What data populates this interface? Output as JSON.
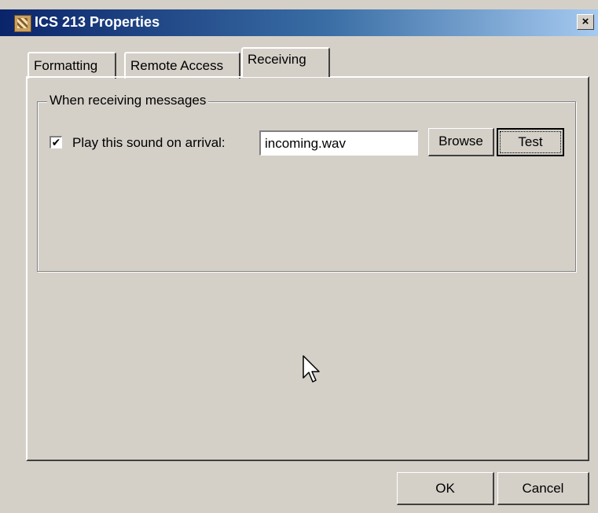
{
  "window": {
    "title": "ICS 213 Properties",
    "close_glyph": "×",
    "icon": "app-icon"
  },
  "tabs": [
    {
      "label": "Formatting",
      "active": false
    },
    {
      "label": "Remote Access",
      "active": false
    },
    {
      "label": "Receiving",
      "active": true
    }
  ],
  "receiving": {
    "group_label": "When receiving messages",
    "play_sound_checked": true,
    "check_glyph": "✔",
    "play_sound_label": "Play this sound on arrival:",
    "sound_file": "incoming.wav",
    "browse_label": "Browse",
    "test_label": "Test"
  },
  "footer": {
    "ok_label": "OK",
    "cancel_label": "Cancel"
  },
  "colors": {
    "dialog_face": "#d4d0c8",
    "title_start": "#0a246a",
    "title_end": "#a6caf0"
  }
}
